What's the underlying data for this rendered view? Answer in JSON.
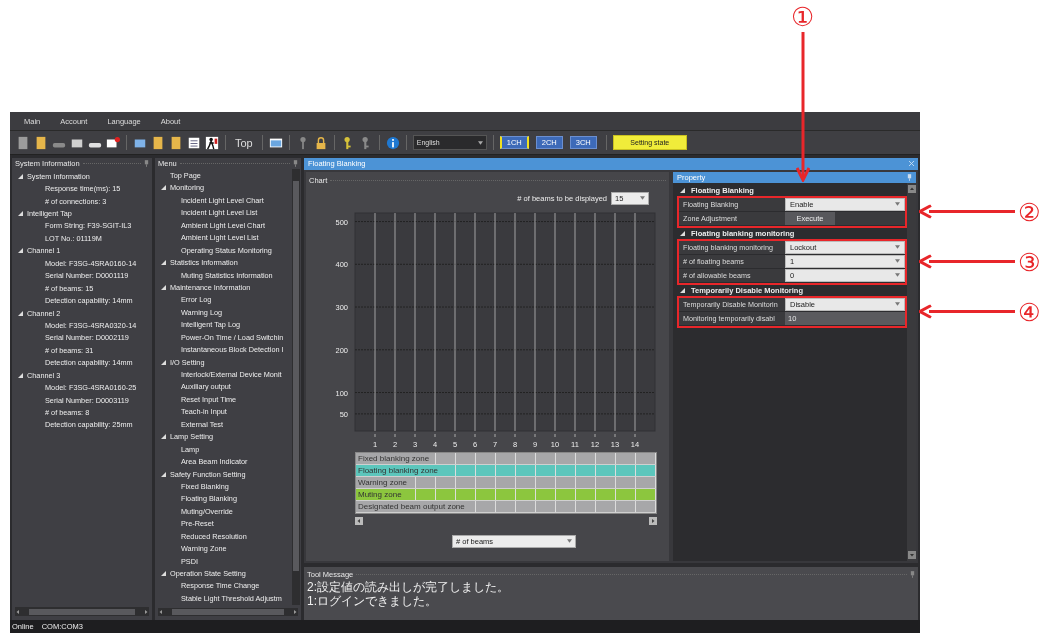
{
  "menubar": [
    "Main",
    "Account",
    "Language",
    "About"
  ],
  "toolbar": {
    "top_button": "Top",
    "language": "English",
    "channels": [
      {
        "label": "1CH",
        "selected": true
      },
      {
        "label": "2CH",
        "selected": false
      },
      {
        "label": "3CH",
        "selected": false
      }
    ],
    "state_button": "Setting state"
  },
  "system_panel": {
    "title": "System Information",
    "items": [
      {
        "label": "System Information",
        "expanded": true,
        "children": [
          {
            "label": "Response time(ms): 15"
          },
          {
            "label": "# of connections: 3"
          }
        ]
      },
      {
        "label": "Intelligent Tap",
        "expanded": true,
        "children": [
          {
            "label": "Form String: F39-SGIT-IL3"
          },
          {
            "label": "LOT No.: 01119M"
          }
        ]
      },
      {
        "label": "Channel 1",
        "expanded": true,
        "children": [
          {
            "label": "Model: F3SG-4SRA0160-14"
          },
          {
            "label": "Serial Number: D0001119"
          },
          {
            "label": "# of beams: 15"
          },
          {
            "label": "Detection capability: 14mm"
          }
        ]
      },
      {
        "label": "Channel 2",
        "expanded": true,
        "children": [
          {
            "label": "Model: F3SG-4SRA0320-14"
          },
          {
            "label": "Serial Number: D0002119"
          },
          {
            "label": "# of beams: 31"
          },
          {
            "label": "Detection capability: 14mm"
          }
        ]
      },
      {
        "label": "Channel 3",
        "expanded": true,
        "children": [
          {
            "label": "Model: F3SG-4SRA0160-25"
          },
          {
            "label": "Serial Number: D0003119"
          },
          {
            "label": "# of beams: 8"
          },
          {
            "label": "Detection capability: 25mm"
          }
        ]
      }
    ]
  },
  "menu_panel": {
    "title": "Menu",
    "items": [
      {
        "label": "Top Page"
      },
      {
        "label": "Monitoring",
        "expanded": true,
        "children": [
          {
            "label": "Incident Light Level Chart"
          },
          {
            "label": "Incident Light Level List"
          },
          {
            "label": "Ambient Light Level Chart"
          },
          {
            "label": "Ambient Light Level List"
          },
          {
            "label": "Operating Status Monitoring"
          }
        ]
      },
      {
        "label": "Statistics Information",
        "expanded": true,
        "children": [
          {
            "label": "Muting Statistics Information"
          }
        ]
      },
      {
        "label": "Maintenance Information",
        "expanded": true,
        "children": [
          {
            "label": "Error Log"
          },
          {
            "label": "Warning Log"
          },
          {
            "label": "Intelligent Tap Log"
          },
          {
            "label": "Power-On Time / Load Switchin"
          },
          {
            "label": "Instantaneous Block Detection I"
          }
        ]
      },
      {
        "label": "I/O Setting",
        "expanded": true,
        "children": [
          {
            "label": "Interlock/External Device Monit"
          },
          {
            "label": "Auxiliary output"
          },
          {
            "label": "Reset Input Time"
          },
          {
            "label": "Teach-in Input"
          },
          {
            "label": "External Test"
          }
        ]
      },
      {
        "label": "Lamp Setting",
        "expanded": true,
        "children": [
          {
            "label": "Lamp"
          },
          {
            "label": "Area Beam Indicator"
          }
        ]
      },
      {
        "label": "Safety Function Setting",
        "expanded": true,
        "children": [
          {
            "label": "Fixed Blanking"
          },
          {
            "label": "Floating Blanking"
          },
          {
            "label": "Muting/Override"
          },
          {
            "label": "Pre-Reset"
          },
          {
            "label": "Reduced Resolution"
          },
          {
            "label": "Warning Zone"
          },
          {
            "label": "PSDI"
          }
        ]
      },
      {
        "label": "Operation State Setting",
        "expanded": true,
        "children": [
          {
            "label": "Response Time Change"
          },
          {
            "label": "Stable Light Threshold Adjustm"
          }
        ]
      }
    ]
  },
  "document": {
    "tab": "Floating Blanking",
    "chart_panel": {
      "title": "Chart",
      "beams_label": "# of beams to be displayed",
      "beams_value": "15",
      "y_ticks": [
        "500",
        "400",
        "300",
        "200",
        "100",
        "50"
      ],
      "x_ticks": [
        "1",
        "2",
        "3",
        "4",
        "5",
        "6",
        "7",
        "8",
        "9",
        "10",
        "11",
        "12",
        "13",
        "14"
      ],
      "zones": [
        {
          "label": "Fixed blanking zone",
          "color": "#a7a7a9"
        },
        {
          "label": "Floating blanking zone",
          "color": "#5cc6bc"
        },
        {
          "label": "Warning zone",
          "color": "#a7a7a9"
        },
        {
          "label": "Muting zone",
          "color": "#8cc63e"
        },
        {
          "label": "Designated beam output zone",
          "color": "#a7a7a9"
        }
      ],
      "axis_select": "# of beams"
    },
    "property_panel": {
      "title": "Property",
      "groups": [
        {
          "title": "Floating Blanking",
          "expanded": true,
          "highlighted": true,
          "callout": "②",
          "rows": [
            {
              "label": "Floating Blanking",
              "kind": "dropdown",
              "value": "Enable"
            },
            {
              "label": "Zone Adjustment",
              "kind": "button",
              "value": "Execute"
            }
          ]
        },
        {
          "title": "Floating blanking monitoring",
          "expanded": true,
          "highlighted": true,
          "callout": "③",
          "rows": [
            {
              "label": "Floating blanking monitoring",
              "kind": "dropdown",
              "value": "Lockout"
            },
            {
              "label": "# of floating beams",
              "kind": "dropdown",
              "value": "1"
            },
            {
              "label": "# of allowable beams",
              "kind": "dropdown",
              "value": "0"
            }
          ]
        },
        {
          "title": "Temporarily Disable Monitoring",
          "expanded": true,
          "highlighted": true,
          "callout": "④",
          "rows": [
            {
              "label": "Temporarily Disable Monitorin",
              "kind": "dropdown",
              "value": "Disable"
            },
            {
              "label": "Monitoring temporarily disabl",
              "kind": "field",
              "value": "10"
            }
          ]
        }
      ]
    }
  },
  "tool_message": {
    "title": "Tool Message",
    "lines": [
      "2:設定値の読み出しが完了しました。",
      "1:ログインできました。"
    ]
  },
  "status_bar": {
    "state": "Online",
    "port": "COM:COM3"
  },
  "annotations": {
    "top_callout": "①"
  }
}
